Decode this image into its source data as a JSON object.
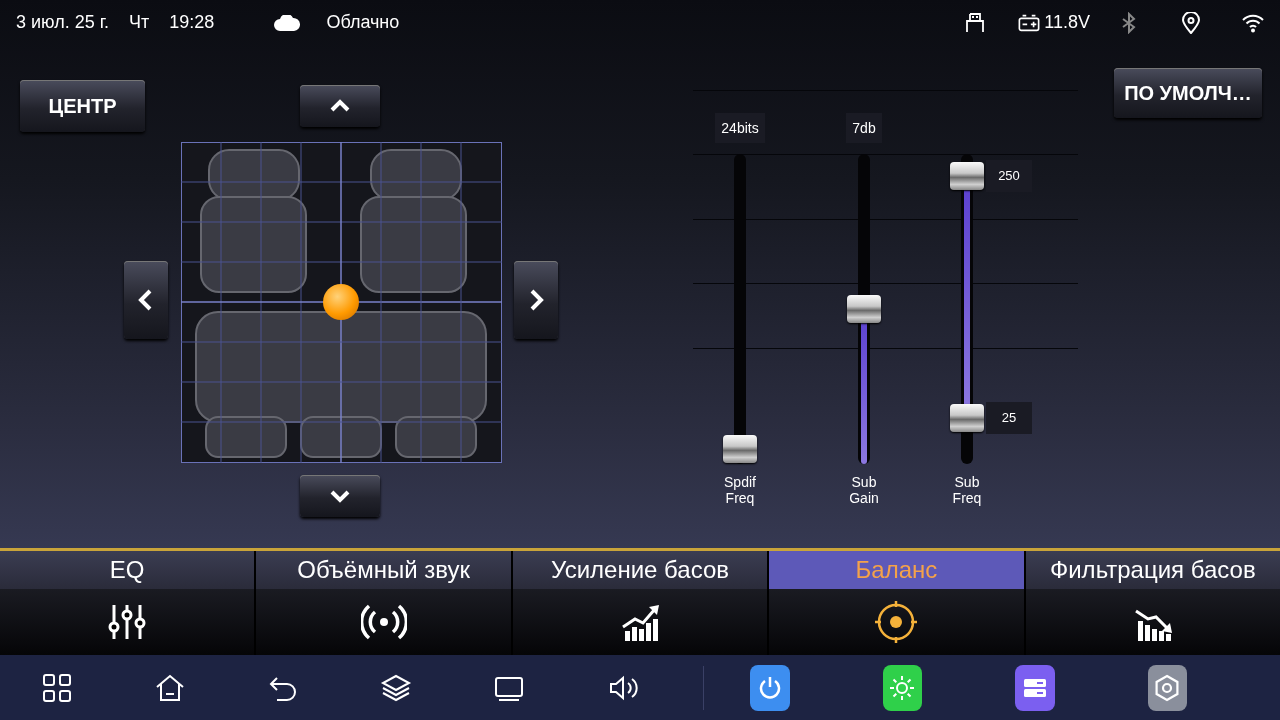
{
  "status_bar": {
    "date": "3 июл. 25 г.",
    "weekday": "Чт",
    "time": "19:28",
    "weather": "Облачно",
    "voltage": "11.8V"
  },
  "balance": {
    "center_button": "ЦЕНТР"
  },
  "default_button": "ПО УМОЛЧ…",
  "sliders": [
    {
      "name": "Spdif\nFreq",
      "reading": "24bits",
      "thumbs": [
        {
          "level": 0.05
        }
      ]
    },
    {
      "name": "Sub\nGain",
      "reading": "7db",
      "thumbs": [
        {
          "level": 0.5
        }
      ]
    },
    {
      "name": "Sub\nFreq",
      "thumbs": [
        {
          "level": 0.93,
          "value": "250"
        },
        {
          "level": 0.15,
          "value": "25"
        }
      ]
    }
  ],
  "tabs": [
    {
      "label": "EQ",
      "selected": false
    },
    {
      "label": "Объёмный звук",
      "selected": false
    },
    {
      "label": "Усиление басов",
      "selected": false
    },
    {
      "label": "Баланс",
      "selected": true
    },
    {
      "label": "Фильтрация басов",
      "selected": false
    }
  ]
}
